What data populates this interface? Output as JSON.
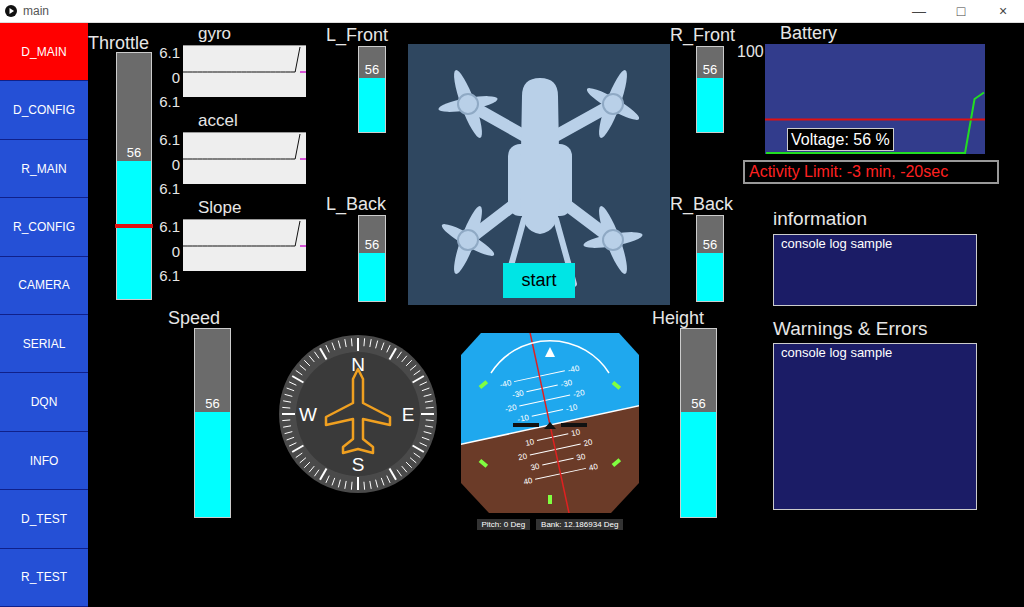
{
  "window": {
    "title": "main",
    "controls": [
      "—",
      "□",
      "×"
    ]
  },
  "sidebar": {
    "items": [
      {
        "label": "D_MAIN",
        "selected": true
      },
      {
        "label": "D_CONFIG",
        "selected": false
      },
      {
        "label": "R_MAIN",
        "selected": false
      },
      {
        "label": "R_CONFIG",
        "selected": false
      },
      {
        "label": "CAMERA",
        "selected": false
      },
      {
        "label": "SERIAL",
        "selected": false
      },
      {
        "label": "DQN",
        "selected": false
      },
      {
        "label": "INFO",
        "selected": false
      },
      {
        "label": "D_TEST",
        "selected": false
      },
      {
        "label": "R_TEST",
        "selected": false
      }
    ]
  },
  "throttle": {
    "label": "Throttle",
    "value": "56",
    "level": 0.56,
    "setpoint": 0.29
  },
  "charts": [
    {
      "label": "gyro",
      "ticks": [
        "6.1",
        "0",
        "6.1"
      ],
      "values": [
        0,
        0,
        0,
        0,
        0,
        0,
        0,
        0,
        0,
        0,
        0,
        0,
        0,
        0,
        0,
        0,
        0,
        0,
        0,
        0,
        0,
        0,
        0,
        0,
        6.1
      ]
    },
    {
      "label": "accel",
      "ticks": [
        "6.1",
        "0",
        "6.1"
      ],
      "values": [
        0,
        0,
        0,
        0,
        0,
        0,
        0,
        0,
        0,
        0,
        0,
        0,
        0,
        0,
        0,
        0,
        0,
        0,
        0,
        0,
        0,
        0,
        0,
        0,
        6.1
      ]
    },
    {
      "label": "Slope",
      "ticks": [
        "6.1",
        "0",
        "6.1"
      ],
      "values": [
        0,
        0,
        0,
        0,
        0,
        0,
        0,
        0,
        0,
        0,
        0,
        0,
        0,
        0,
        0,
        0,
        0,
        0,
        0,
        0,
        0,
        0,
        0,
        0,
        6.1
      ]
    }
  ],
  "motors": {
    "left": [
      {
        "label": "L_Front",
        "value": "56",
        "level": 0.64
      },
      {
        "label": "L_Back",
        "value": "56",
        "level": 0.56
      }
    ],
    "right": [
      {
        "label": "R_Front",
        "value": "56",
        "level": 0.64
      },
      {
        "label": "R_Back",
        "value": "56",
        "level": 0.56
      }
    ]
  },
  "control_panel": {
    "button": "start"
  },
  "speed": {
    "label": "Speed",
    "value": "56",
    "level": 0.56
  },
  "height": {
    "label": "Height",
    "value": "56",
    "level": 0.56
  },
  "compass": {
    "heading": 0,
    "cardinals": [
      "N",
      "E",
      "S",
      "W"
    ]
  },
  "attitude": {
    "pitch": 0,
    "bank": 12.186934,
    "pitch_up_labels": [
      "-40",
      "-30",
      "-20",
      "-10"
    ],
    "pitch_down_labels": [
      "10",
      "20",
      "30",
      "40"
    ],
    "readings": [
      "Pitch: 0 Deg",
      "Bank: 12.186934 Deg"
    ]
  },
  "battery": {
    "label": "Battery",
    "max": "100",
    "voltage": "Voltage: 56 %",
    "threshold": 31,
    "values": [
      0,
      0,
      0,
      0,
      0,
      0,
      0,
      0,
      0,
      0,
      0,
      0,
      0,
      0,
      0,
      0,
      0,
      0,
      0,
      0,
      0,
      0,
      50,
      56
    ]
  },
  "activity_limit": "Activity Limit: -3 min, -20sec",
  "information": {
    "title": "information",
    "lines": [
      "console log sample"
    ]
  },
  "warnings": {
    "title": "Warnings & Errors",
    "lines": [
      "console log sample"
    ]
  }
}
